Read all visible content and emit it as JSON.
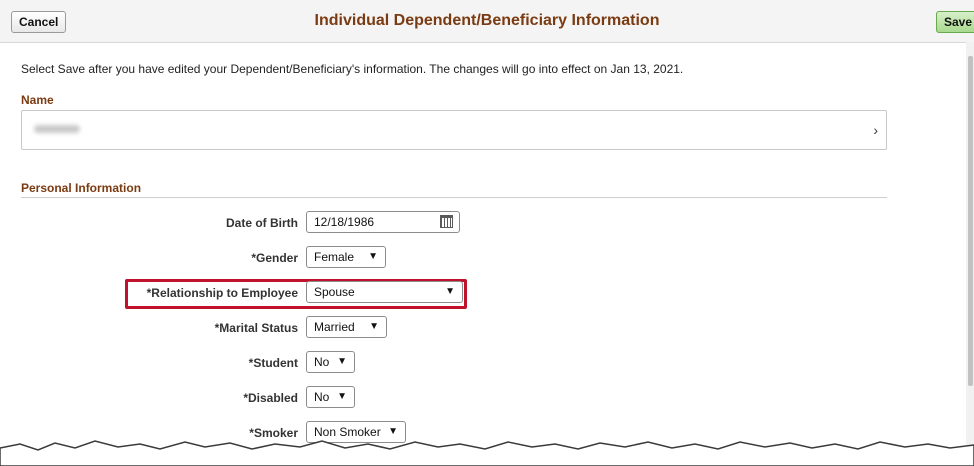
{
  "header": {
    "title": "Individual Dependent/Beneficiary Information",
    "cancel_label": "Cancel",
    "save_label": "Save"
  },
  "instruction": "Select Save after you have edited your Dependent/Beneficiary's information.  The changes will go into effect on Jan 13, 2021.",
  "name_section": {
    "label": "Name",
    "chevron": "›"
  },
  "personal": {
    "label": "Personal Information",
    "fields": {
      "dob": {
        "label": "Date of Birth",
        "value": "12/18/1986"
      },
      "gender": {
        "label": "*Gender",
        "value": "Female"
      },
      "relationship": {
        "label": "*Relationship to Employee",
        "value": "Spouse"
      },
      "marital": {
        "label": "*Marital Status",
        "value": "Married"
      },
      "student": {
        "label": "*Student",
        "value": "No"
      },
      "disabled": {
        "label": "*Disabled",
        "value": "No"
      },
      "smoker": {
        "label": "*Smoker",
        "value": "Non Smoker"
      }
    }
  },
  "icons": {
    "calendar": "calendar-icon",
    "dropdown": "chevron-down-icon",
    "row_chevron": "chevron-right-icon"
  },
  "colors": {
    "title": "#7b3b12",
    "highlight": "#c0122b",
    "save_bg": "#a9d98e"
  }
}
